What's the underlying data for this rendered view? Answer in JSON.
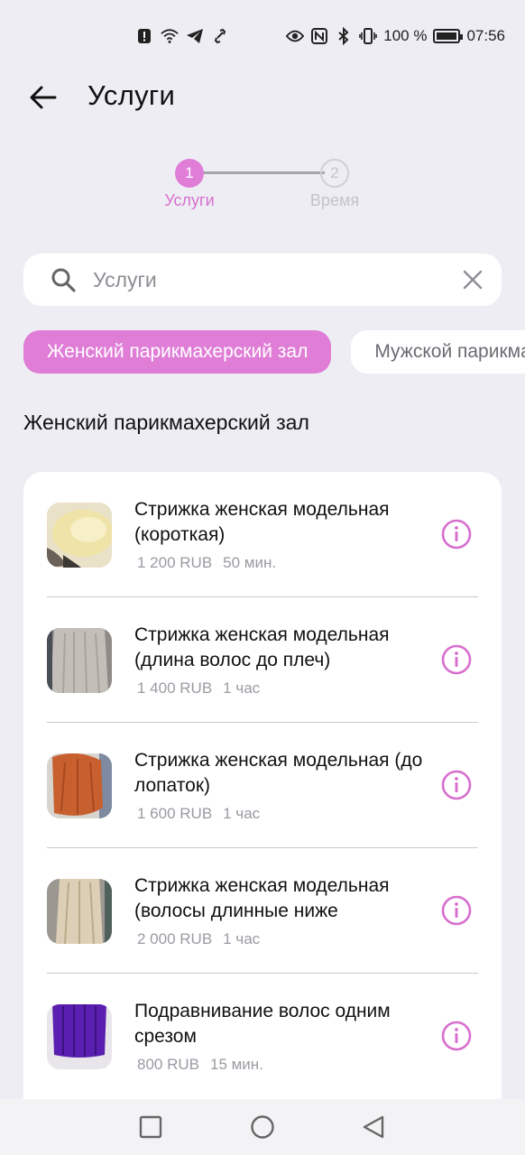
{
  "status_bar": {
    "battery_percent": "100 %",
    "time": "07:56",
    "icons": [
      "alert-icon",
      "wifi-icon",
      "telegram-icon",
      "link-icon",
      "eye-icon",
      "nfc-icon",
      "bluetooth-icon",
      "vibrate-icon",
      "battery-icon"
    ]
  },
  "header": {
    "title": "Услуги"
  },
  "stepper": {
    "steps": [
      {
        "number": "1",
        "label": "Услуги",
        "state": "active"
      },
      {
        "number": "2",
        "label": "Время",
        "state": "inactive"
      }
    ]
  },
  "search": {
    "placeholder": "Услуги",
    "value": ""
  },
  "categories": [
    {
      "label": "Женский парикмахерский зал",
      "active": true
    },
    {
      "label": "Мужской парикмахерский зал",
      "active": false
    }
  ],
  "section": {
    "title": "Женский парикмахерский зал"
  },
  "services": [
    {
      "name": "Стрижка женская модельная (короткая)",
      "price": "1 200 RUB",
      "duration": "50 мин.",
      "thumb_color": "#e6d9b0"
    },
    {
      "name": "Стрижка женская модельная (длина волос до плеч)",
      "price": "1 400 RUB",
      "duration": "1 час",
      "thumb_color": "#b9b2ad"
    },
    {
      "name": "Стрижка женская модельная (до лопаток)",
      "price": "1 600 RUB",
      "duration": "1 час",
      "thumb_color": "#c95a2a"
    },
    {
      "name": "Стрижка женская модельная (волосы длинные ниже",
      "price": "2 000 RUB",
      "duration": "1 час",
      "thumb_color": "#cdbfa6"
    },
    {
      "name": "Подравнивание волос одним срезом",
      "price": "800 RUB",
      "duration": "15 мин.",
      "thumb_color": "#5a1fb0"
    }
  ],
  "colors": {
    "accent": "#df7dd7",
    "background": "#eeedf4",
    "card": "#ffffff",
    "muted_text": "#9a9aa2"
  }
}
